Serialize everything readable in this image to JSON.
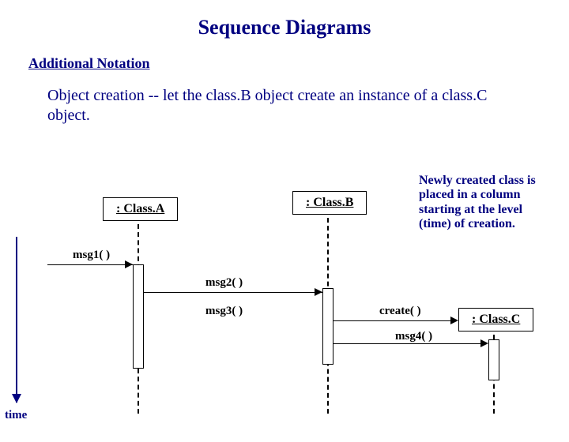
{
  "title": "Sequence Diagrams",
  "subtitle": "Additional Notation",
  "desc": "Object creation  --  let the class.B object create an instance of a class.C object.",
  "objects": {
    "A": ": Class.A",
    "B": ": Class.B",
    "C": ": Class.C"
  },
  "messages": {
    "m1": "msg1( )",
    "m2": "msg2( )",
    "m3": "msg3( )",
    "m4": "msg4( )",
    "create": "create( )"
  },
  "note": "Newly created class is placed in a column starting at the level (time) of creation.",
  "timelabel": "time"
}
